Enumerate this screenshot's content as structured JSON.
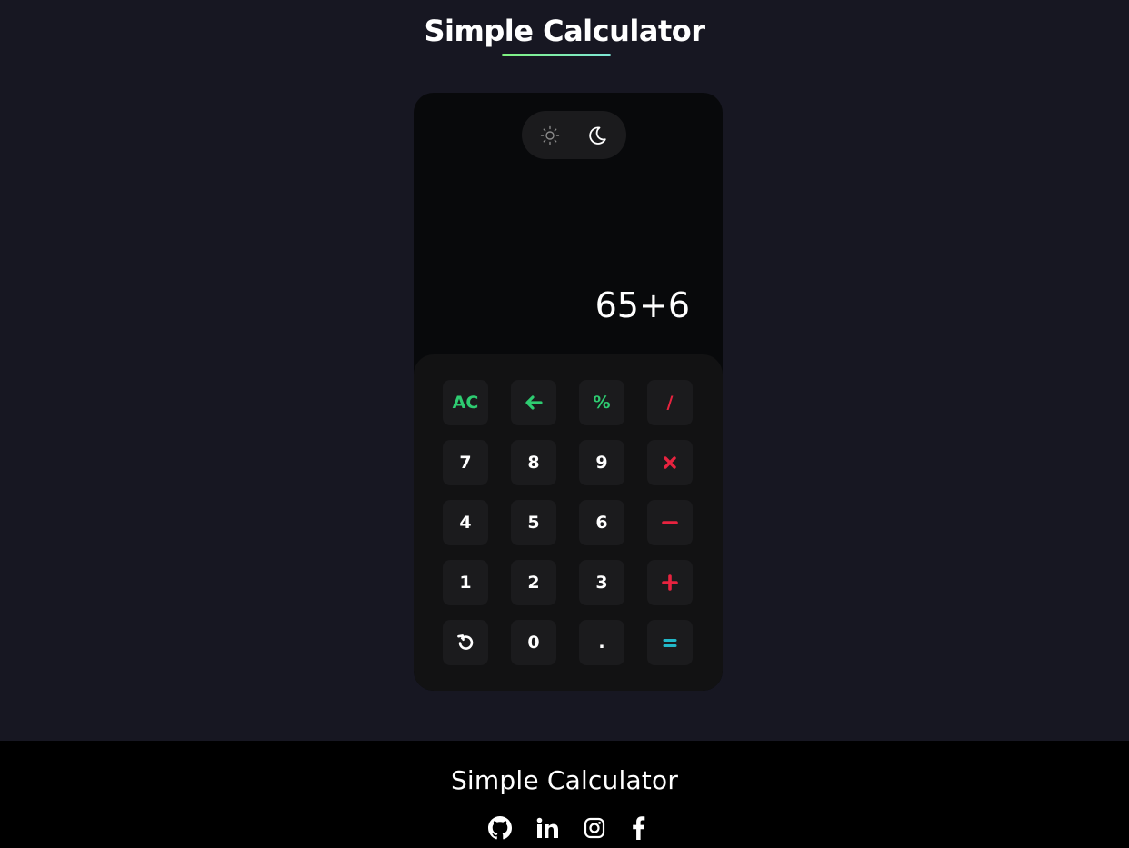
{
  "header": {
    "title": "Simple Calculator"
  },
  "theme_toggle": {
    "light_icon": "sun-icon",
    "dark_icon": "moon-icon",
    "active": "dark"
  },
  "display": {
    "expression": "65+6"
  },
  "keys": [
    {
      "label": "AC",
      "icon": null,
      "color": "#2ecc71"
    },
    {
      "label": null,
      "icon": "arrow-left-icon",
      "color": "#2ecc71"
    },
    {
      "label": "%",
      "icon": null,
      "color": "#2ecc71"
    },
    {
      "label": "/",
      "icon": null,
      "color": "#e8233f"
    },
    {
      "label": "7",
      "icon": null,
      "color": "#ffffff"
    },
    {
      "label": "8",
      "icon": null,
      "color": "#ffffff"
    },
    {
      "label": "9",
      "icon": null,
      "color": "#ffffff"
    },
    {
      "label": null,
      "icon": "multiply-icon",
      "color": "#e8233f"
    },
    {
      "label": "4",
      "icon": null,
      "color": "#ffffff"
    },
    {
      "label": "5",
      "icon": null,
      "color": "#ffffff"
    },
    {
      "label": "6",
      "icon": null,
      "color": "#ffffff"
    },
    {
      "label": null,
      "icon": "minus-icon",
      "color": "#e8233f"
    },
    {
      "label": "1",
      "icon": null,
      "color": "#ffffff"
    },
    {
      "label": "2",
      "icon": null,
      "color": "#ffffff"
    },
    {
      "label": "3",
      "icon": null,
      "color": "#ffffff"
    },
    {
      "label": null,
      "icon": "plus-icon",
      "color": "#e8233f"
    },
    {
      "label": null,
      "icon": "reset-icon",
      "color": "#ffffff"
    },
    {
      "label": "0",
      "icon": null,
      "color": "#ffffff"
    },
    {
      "label": ".",
      "icon": null,
      "color": "#ffffff"
    },
    {
      "label": null,
      "icon": "equals-icon",
      "color": "#22b8c8"
    }
  ],
  "footer": {
    "title": "Simple Calculator",
    "social": [
      "github-icon",
      "linkedin-icon",
      "instagram-icon",
      "facebook-icon"
    ]
  },
  "colors": {
    "background": "#171722",
    "calculator": "#08090b",
    "keypad": "#121213",
    "key": "#1b1b1d",
    "underline_start": "#7ff27f",
    "underline_end": "#7fe8d8",
    "green": "#2ecc71",
    "red": "#e8233f",
    "teal": "#22b8c8"
  }
}
